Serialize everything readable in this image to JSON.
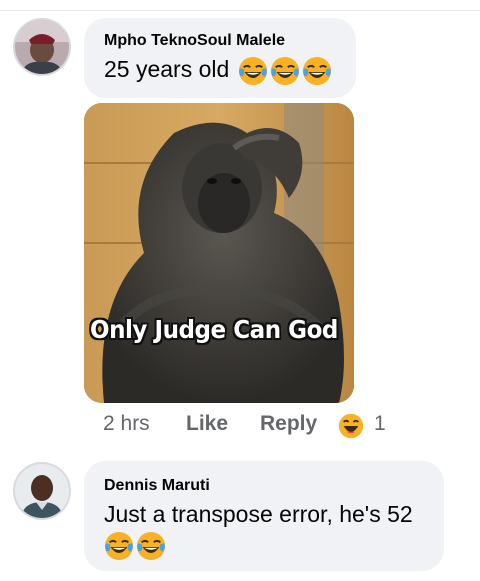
{
  "comments": [
    {
      "author": "Mpho TeknoSoul Malele",
      "text": "25 years old",
      "emojis": [
        "tears-of-joy-emoji",
        "tears-of-joy-emoji",
        "tears-of-joy-emoji"
      ],
      "meme_caption": "Only Judge Can God",
      "actions": {
        "time": "2 hrs",
        "like_label": "Like",
        "reply_label": "Reply",
        "reaction_count": "1",
        "reaction_icon": "laughing-reaction-icon"
      }
    },
    {
      "author": "Dennis Maruti",
      "text": "Just a transpose error, he's 52",
      "emojis": [
        "tears-of-joy-emoji",
        "tears-of-joy-emoji"
      ]
    }
  ],
  "colors": {
    "bubble": "#f0f2f5",
    "meta_text": "#65676b",
    "text": "#050505",
    "emoji_yellow": "#f7b125"
  }
}
